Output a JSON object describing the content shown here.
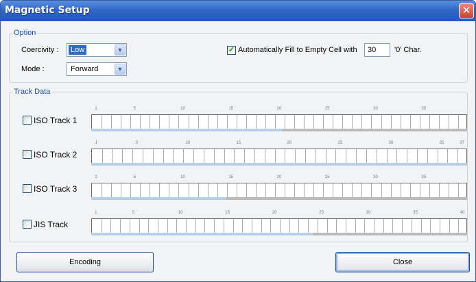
{
  "window": {
    "title": "Magnetic Setup",
    "close_glyph": "✕"
  },
  "option": {
    "legend": "Option",
    "coercivity": {
      "label": "Coercivity :",
      "value": "Low",
      "options": [
        "Low"
      ]
    },
    "mode": {
      "label": "Mode :",
      "value": "Forward"
    },
    "autofill": {
      "checked": true,
      "label": "Automatically Fill to Empty Cell with",
      "value": "30",
      "suffix": "'0'  Char."
    }
  },
  "track_data": {
    "legend": "Track Data",
    "tracks": [
      {
        "label": "ISO Track 1",
        "checked": false,
        "cells": 39,
        "ticks": [
          "1",
          "5",
          "10",
          "15",
          "20",
          "25",
          "30",
          "35"
        ],
        "fill_fraction": 0.51
      },
      {
        "label": "ISO Track 2",
        "checked": false,
        "cells": 37,
        "ticks": [
          "1",
          "5",
          "10",
          "15",
          "20",
          "25",
          "30",
          "35",
          "37"
        ],
        "fill_fraction": 1.0
      },
      {
        "label": "ISO Track 3",
        "checked": false,
        "cells": 39,
        "ticks": [
          "1",
          "5",
          "10",
          "15",
          "20",
          "25",
          "30",
          "35"
        ],
        "fill_fraction": 0.36
      },
      {
        "label": "JIS Track",
        "checked": false,
        "cells": 40,
        "ticks": [
          "1",
          "5",
          "10",
          "15",
          "20",
          "25",
          "30",
          "35",
          "40"
        ],
        "fill_fraction": 0.59
      }
    ]
  },
  "buttons": {
    "encoding": "Encoding",
    "close": "Close"
  },
  "icons": {
    "dropdown": "chevron-down-icon",
    "check": "checkmark-icon"
  },
  "colors": {
    "title_bar": "#2f68c8",
    "legend_text": "#1a4fa0",
    "selection": "#316ac5",
    "close": "#c8452f"
  }
}
